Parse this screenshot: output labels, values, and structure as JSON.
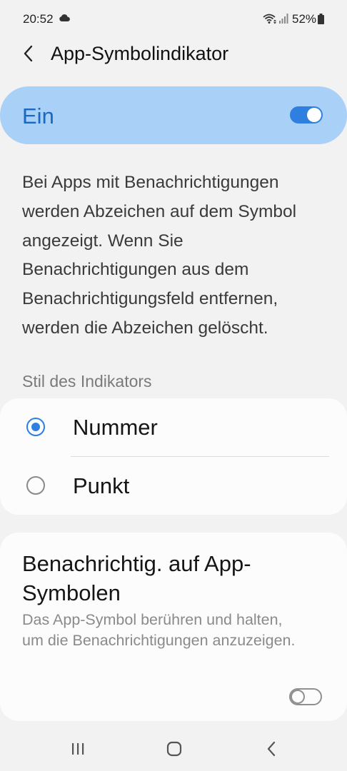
{
  "status_bar": {
    "time": "20:52",
    "battery": "52%",
    "icons": [
      "cloud-icon",
      "wifi-icon",
      "signal-icon",
      "battery-icon"
    ]
  },
  "header": {
    "title": "App-Symbolindikator",
    "back_icon": "chevron-left-icon"
  },
  "master_switch": {
    "label": "Ein",
    "state": "on"
  },
  "description": "Bei Apps mit Benachrichtigungen werden Abzeichen auf dem Symbol angezeigt. Wenn Sie Benachrichtigungen aus dem Benachrichtigungsfeld entfernen, werden die Abzeichen gelöscht.",
  "indicator_style": {
    "section_title": "Stil des Indikators",
    "options": [
      {
        "label": "Nummer",
        "selected": true
      },
      {
        "label": "Punkt",
        "selected": false
      }
    ]
  },
  "app_icon_notifications": {
    "title": "Benachrichtig. auf App-Symbolen",
    "subtitle": "Das App-Symbol berühren und halten, um die Benachrichtigungen anzuzeigen.",
    "state": "off"
  },
  "nav_bar": {
    "buttons": [
      "recent-apps-icon",
      "home-icon",
      "back-icon"
    ]
  },
  "colors": {
    "accent": "#2f7fe0",
    "master_bg": "#a9d0f7",
    "master_label": "#1868c4",
    "background": "#f2f2f2",
    "card": "#fcfcfc"
  }
}
